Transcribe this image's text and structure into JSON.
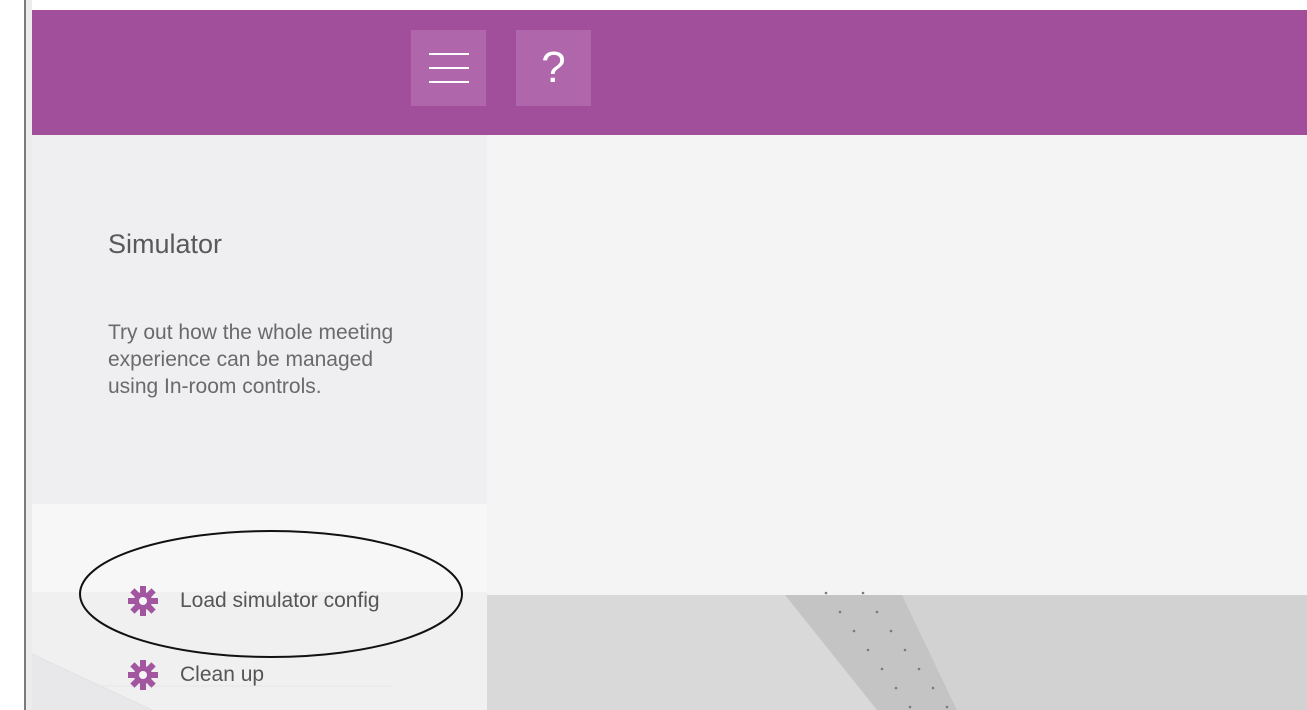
{
  "header": {
    "menu_icon": "hamburger-menu-icon",
    "help_label": "?",
    "color": "#a14f9b",
    "button_color": "#b066ab"
  },
  "sidebar": {
    "title": "Simulator",
    "description": "Try out how the whole meeting experience can be managed using In-room controls.",
    "actions": [
      {
        "label": "Load simulator config",
        "icon": "gear-icon"
      },
      {
        "label": "Clean up",
        "icon": "gear-icon"
      }
    ],
    "icon_color": "#a356a0"
  }
}
